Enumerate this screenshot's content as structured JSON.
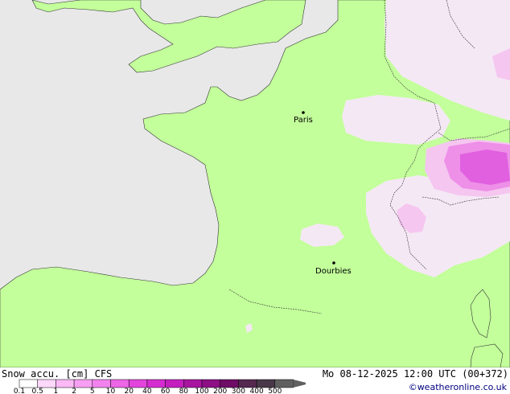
{
  "map": {
    "colors": {
      "sea": "#e8e8e8",
      "land": "#c3ff9b",
      "border": "#333333",
      "snow_trace": "#f5e8f5",
      "snow_light": "#f5c6f0",
      "snow_med": "#ee8fe8",
      "snow_strong": "#e060e0"
    },
    "cities": [
      {
        "name": "Paris"
      },
      {
        "name": "Dourbies"
      }
    ]
  },
  "footer": {
    "title": "Snow accu. [cm] CFS",
    "datetime": "Mo 08-12-2025 12:00 UTC (00+372)",
    "credit": "©weatheronline.co.uk"
  },
  "legend": {
    "ticks": [
      "0.1",
      "0.5",
      "1",
      "2",
      "5",
      "10",
      "20",
      "40",
      "60",
      "80",
      "100",
      "200",
      "300",
      "400",
      "500"
    ],
    "colors": [
      "#ffffff",
      "#fdd8fb",
      "#fbb9f6",
      "#f79ff2",
      "#f283ee",
      "#ec66e6",
      "#e244dc",
      "#d42cd0",
      "#c51fc0",
      "#a8159f",
      "#8c0f84",
      "#6e0c66",
      "#55284f",
      "#483848",
      "#606060"
    ]
  }
}
